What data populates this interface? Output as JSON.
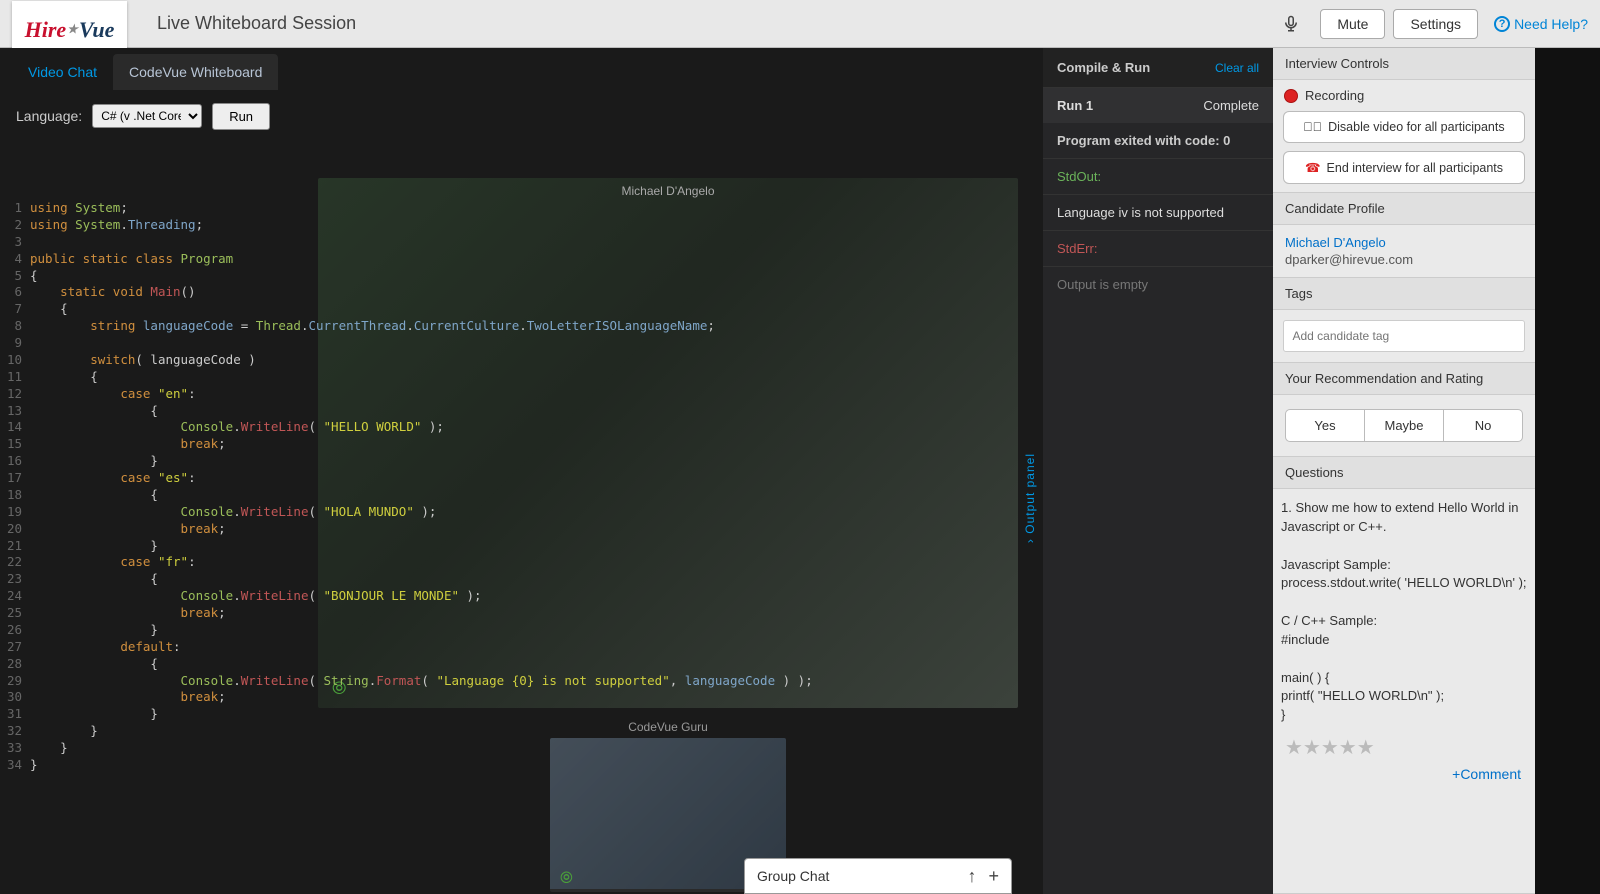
{
  "header": {
    "logo_prefix": "Hire",
    "logo_star": "★",
    "logo_suffix": "Vue",
    "title": "Live Whiteboard Session",
    "mute": "Mute",
    "settings": "Settings",
    "help": "Need Help?"
  },
  "tabs": {
    "video": "Video Chat",
    "codevue": "CodeVue Whiteboard"
  },
  "editor": {
    "language_label": "Language:",
    "language_value": "C# (v .Net Core)",
    "run": "Run",
    "participant_main": "Michael D'Angelo",
    "participant_small": "CodeVue Guru",
    "output_panel": "Output panel",
    "output_panel_arrow": "›"
  },
  "code": {
    "l1": {
      "kw": "using ",
      "type": "System",
      "pl": ";"
    },
    "l2": {
      "kw": "using ",
      "type": "System",
      "pl1": ".",
      "id": "Threading",
      "pl2": ";"
    },
    "l3": "",
    "l4": {
      "kw": "public static class ",
      "type": "Program"
    },
    "l5": "{",
    "l6": {
      "indent": "    ",
      "kw": "static void ",
      "fn": "Main",
      "pl": "()"
    },
    "l7": "    {",
    "l8": {
      "indent": "        ",
      "kw": "string ",
      "id": "languageCode",
      "pl1": " = ",
      "type1": "Thread",
      "pl2": ".",
      "id2": "CurrentThread",
      "pl3": ".",
      "id3": "CurrentCulture",
      "pl4": ".",
      "id4": "TwoLetterISOLanguageName",
      "pl5": ";"
    },
    "l9": "",
    "l10": {
      "indent": "        ",
      "kw": "switch",
      "pl": "( languageCode )"
    },
    "l11": "        {",
    "l12": {
      "indent": "            ",
      "kw": "case ",
      "str": "\"en\"",
      "pl": ":"
    },
    "l13": "                {",
    "l14": {
      "indent": "                    ",
      "type": "Console",
      "pl1": ".",
      "fn": "WriteLine",
      "pl2": "( ",
      "str": "\"HELLO WORLD\"",
      "pl3": " );"
    },
    "l15": {
      "indent": "                    ",
      "kw": "break",
      "pl": ";"
    },
    "l16": "                }",
    "l17": {
      "indent": "            ",
      "kw": "case ",
      "str": "\"es\"",
      "pl": ":"
    },
    "l18": "                {",
    "l19": {
      "indent": "                    ",
      "type": "Console",
      "pl1": ".",
      "fn": "WriteLine",
      "pl2": "( ",
      "str": "\"HOLA MUNDO\"",
      "pl3": " );"
    },
    "l20": {
      "indent": "                    ",
      "kw": "break",
      "pl": ";"
    },
    "l21": "                }",
    "l22": {
      "indent": "            ",
      "kw": "case ",
      "str": "\"fr\"",
      "pl": ":"
    },
    "l23": "                {",
    "l24": {
      "indent": "                    ",
      "type": "Console",
      "pl1": ".",
      "fn": "WriteLine",
      "pl2": "( ",
      "str": "\"BONJOUR LE MONDE\"",
      "pl3": " );"
    },
    "l25": {
      "indent": "                    ",
      "kw": "break",
      "pl": ";"
    },
    "l26": "                }",
    "l27": {
      "indent": "            ",
      "kw": "default",
      "pl": ":"
    },
    "l28": "                {",
    "l29": {
      "indent": "                    ",
      "type": "Console",
      "pl1": ".",
      "fn": "WriteLine",
      "pl2": "( ",
      "type2": "String",
      "pl3": ".",
      "fn2": "Format",
      "pl4": "( ",
      "str": "\"Language {0} is not supported\"",
      "pl5": ", ",
      "id": "languageCode",
      "pl6": " ) );"
    },
    "l30": {
      "indent": "                    ",
      "kw": "break",
      "pl": ";"
    },
    "l31": "                }",
    "l32": "        }",
    "l33": "    }",
    "l34": "}"
  },
  "output": {
    "header": "Compile & Run",
    "clear": "Clear all",
    "run_label": "Run 1",
    "status": "Complete",
    "exit": "Program exited with code: 0",
    "stdout_label": "StdOut:",
    "stdout_msg": "Language iv is not supported",
    "stderr_label": "StdErr:",
    "empty": "Output is empty"
  },
  "sidebar": {
    "controls_h": "Interview Controls",
    "recording": "Recording",
    "disable_video": "Disable video for all participants",
    "end_interview": "End interview for all participants",
    "profile_h": "Candidate Profile",
    "candidate_name": "Michael D'Angelo",
    "candidate_email": "dparker@hirevue.com",
    "tags_h": "Tags",
    "tag_placeholder": "Add candidate tag",
    "rec_h": "Your Recommendation and Rating",
    "yes": "Yes",
    "maybe": "Maybe",
    "no": "No",
    "questions_h": "Questions",
    "q1": "1.   Show me how to extend Hello World in Javascript or C++.",
    "js_h": "Javascript Sample:",
    "js_body": "process.stdout.write( 'HELLO WORLD\\n' );",
    "c_h": "C / C++ Sample:",
    "c_inc": "#include",
    "c_main": "main( ) {",
    "c_printf": "printf( \"HELLO WORLD\\n\" );",
    "c_close": "}",
    "stars": "★★★★★",
    "comment": "+Comment"
  },
  "chat": {
    "label": "Group Chat",
    "up": "↑",
    "plus": "+"
  }
}
